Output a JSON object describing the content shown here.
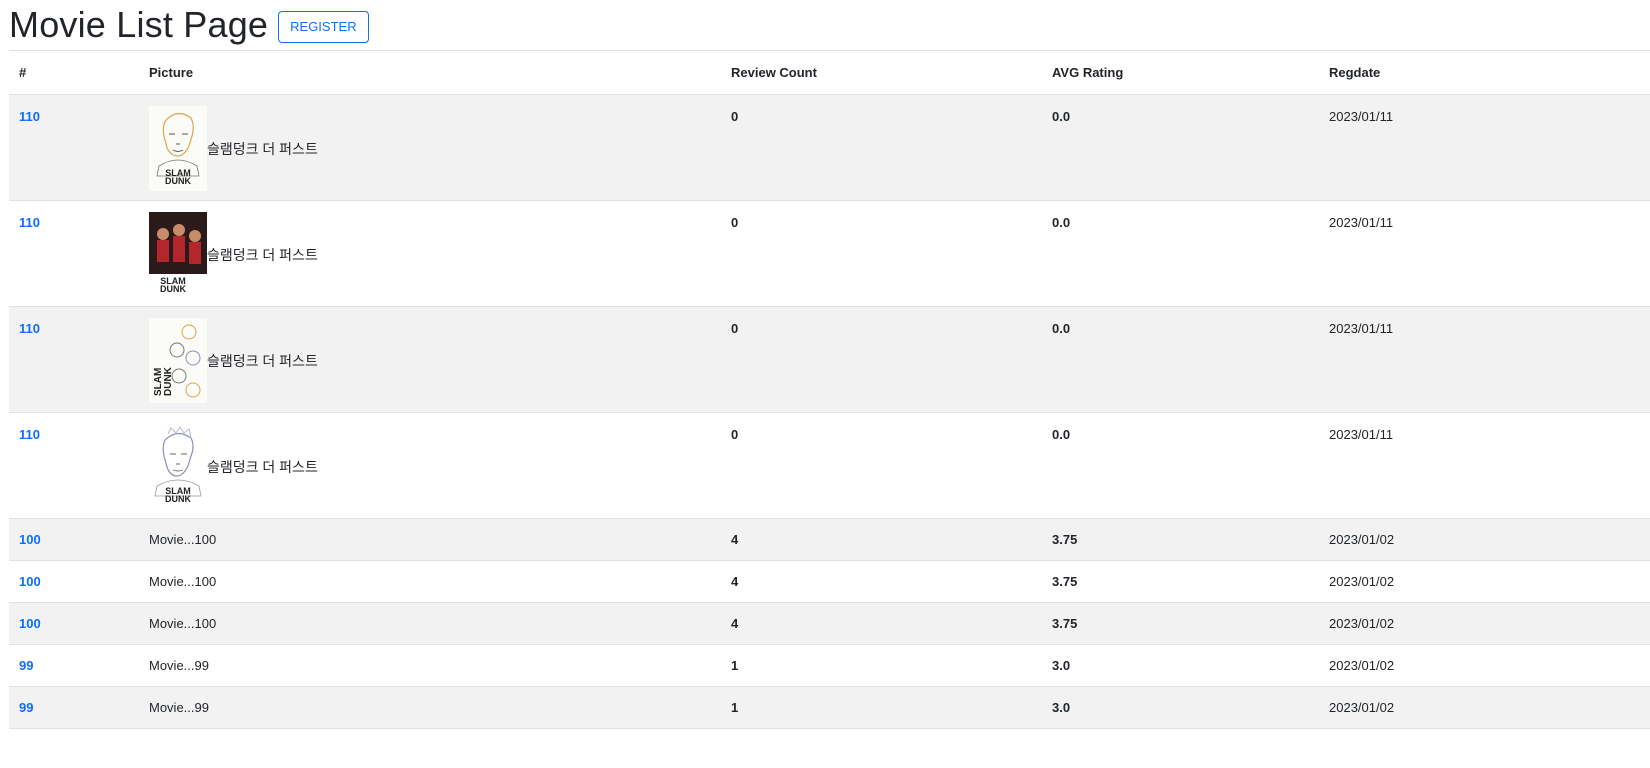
{
  "header": {
    "title": "Movie List Page",
    "register_label": "REGISTER"
  },
  "table": {
    "columns": [
      "#",
      "Picture",
      "Review Count",
      "AVG Rating",
      "Regdate"
    ],
    "rows": [
      {
        "mno": "110",
        "title": "슬램덩크 더 퍼스트",
        "poster": "poster-sketch-sakuragi",
        "review_count": "0",
        "avg_rating": "0.0",
        "regdate": "2023/01/11"
      },
      {
        "mno": "110",
        "title": "슬램덩크 더 퍼스트",
        "poster": "poster-team-red",
        "review_count": "0",
        "avg_rating": "0.0",
        "regdate": "2023/01/11"
      },
      {
        "mno": "110",
        "title": "슬램덩크 더 퍼스트",
        "poster": "poster-sketch-group",
        "review_count": "0",
        "avg_rating": "0.0",
        "regdate": "2023/01/11"
      },
      {
        "mno": "110",
        "title": "슬램덩크 더 퍼스트",
        "poster": "poster-sketch-rukawa",
        "review_count": "0",
        "avg_rating": "0.0",
        "regdate": "2023/01/11"
      },
      {
        "mno": "100",
        "title": "Movie...100",
        "poster": "",
        "review_count": "4",
        "avg_rating": "3.75",
        "regdate": "2023/01/02"
      },
      {
        "mno": "100",
        "title": "Movie...100",
        "poster": "",
        "review_count": "4",
        "avg_rating": "3.75",
        "regdate": "2023/01/02"
      },
      {
        "mno": "100",
        "title": "Movie...100",
        "poster": "",
        "review_count": "4",
        "avg_rating": "3.75",
        "regdate": "2023/01/02"
      },
      {
        "mno": "99",
        "title": "Movie...99",
        "poster": "",
        "review_count": "1",
        "avg_rating": "3.0",
        "regdate": "2023/01/02"
      },
      {
        "mno": "99",
        "title": "Movie...99",
        "poster": "",
        "review_count": "1",
        "avg_rating": "3.0",
        "regdate": "2023/01/02"
      }
    ]
  },
  "poster_text": {
    "slam": "SLAM",
    "dunk": "DUNK"
  },
  "colors": {
    "link": "#0d6efd",
    "stripe": "#f2f2f2",
    "poster_red": "#b3262c",
    "poster_dark": "#2a1a1a"
  }
}
